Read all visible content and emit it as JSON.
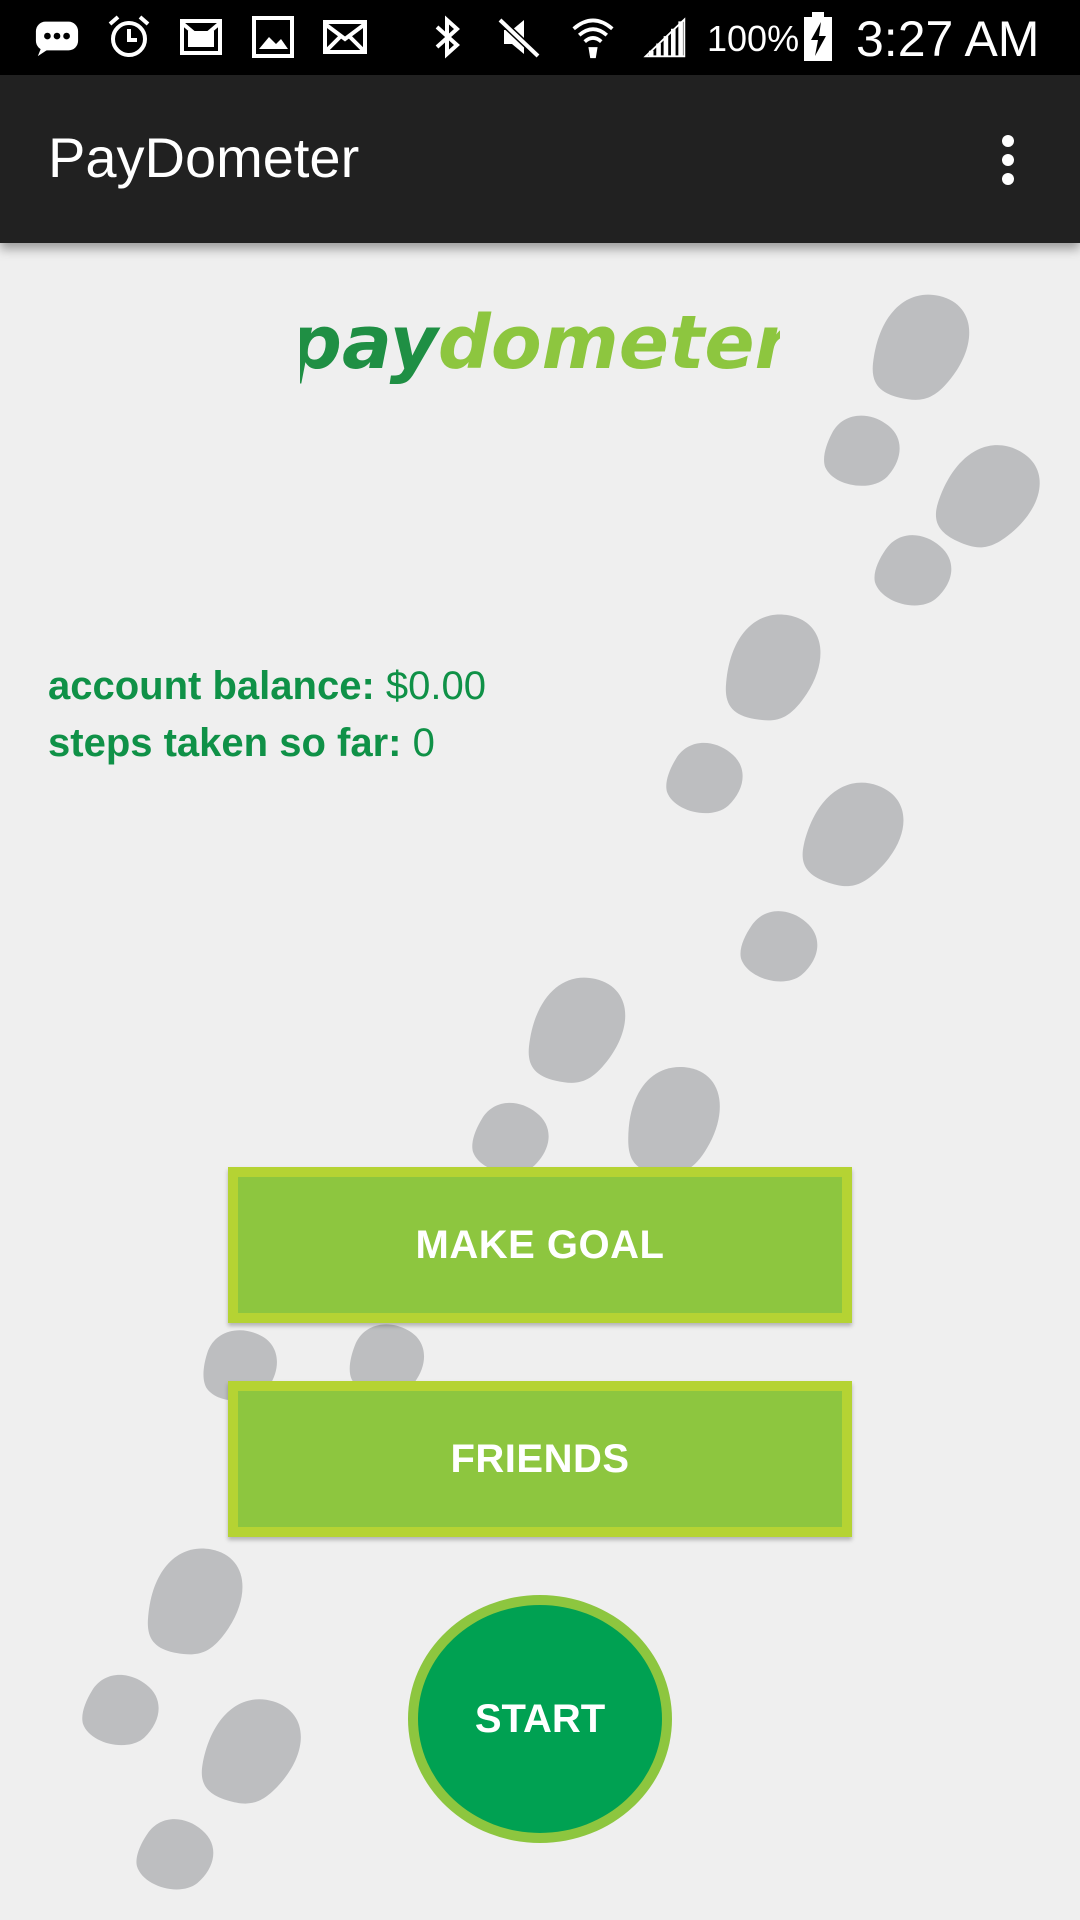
{
  "status_bar": {
    "icons": [
      "messenger-icon",
      "alarm-icon",
      "gmail-icon",
      "gallery-icon",
      "email-icon",
      "bluetooth-icon",
      "mute-icon",
      "wifi-icon",
      "signal-icon",
      "battery-charging-icon"
    ],
    "battery": "100%",
    "time": "3:27 AM"
  },
  "app_bar": {
    "title": "PayDometer",
    "menu_icon": "overflow-menu-icon"
  },
  "logo": {
    "part1": "pay",
    "part2": "dometer",
    "color1": "#1f8f44",
    "color2": "#8dc63f"
  },
  "info": {
    "balance_label": "account balance:",
    "balance_value": "$0.00",
    "steps_label": "steps taken so far:",
    "steps_value": "0"
  },
  "buttons": {
    "make_goal": "MAKE GOAL",
    "friends": "FRIENDS",
    "start": "START"
  },
  "colors": {
    "accent_green": "#8dc63f",
    "button_border": "#b5d333",
    "start_green": "#00a152",
    "text_green": "#0f9147",
    "app_bar": "#212121",
    "background": "#efefef",
    "footprint": "#bdbec0"
  }
}
